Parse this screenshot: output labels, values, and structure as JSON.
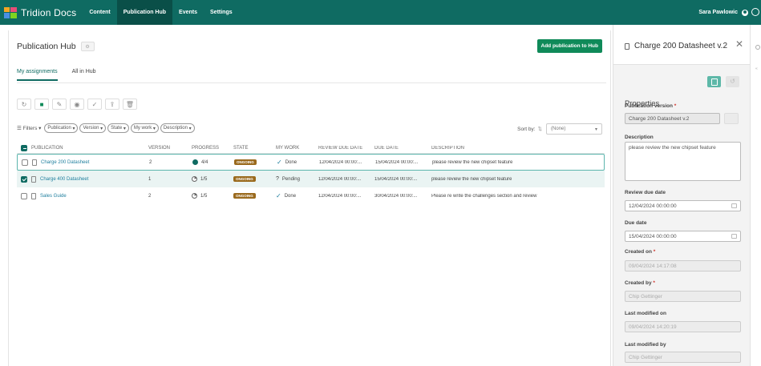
{
  "app": {
    "name": "Tridion Docs"
  },
  "nav": [
    "Content",
    "Publication Hub",
    "Events",
    "Settings"
  ],
  "user": {
    "name": "Sara Pawlowic"
  },
  "page": {
    "title": "Publication Hub",
    "add_button": "Add publication to Hub"
  },
  "tabs": [
    "My assignments",
    "All in Hub"
  ],
  "filters": {
    "label": "Filters",
    "chips": [
      "Publication",
      "Version",
      "State",
      "My work",
      "Description"
    ]
  },
  "sort": {
    "label": "Sort by:",
    "value": "(None)"
  },
  "columns": [
    "PUBLICATION",
    "VERSION",
    "PROGRESS",
    "STATE",
    "MY WORK",
    "REVIEW DUE DATE",
    "DUE DATE",
    "DESCRIPTION"
  ],
  "rows": [
    {
      "publication": "Charge 200 Datasheet",
      "version": "2",
      "progress": "4/4",
      "state": "ONGOING",
      "my_work": "Done",
      "review_due": "12/04/2024 00:00:...",
      "due": "15/04/2024 00:00:...",
      "description": "please review the new chipset feature"
    },
    {
      "publication": "Charge 400 Datasheet",
      "version": "1",
      "progress": "1/5",
      "state": "ONGOING",
      "my_work": "Pending",
      "review_due": "12/04/2024 00:00:...",
      "due": "15/04/2024 00:00:...",
      "description": "please review the new chipset feature"
    },
    {
      "publication": "Sales Guide",
      "version": "2",
      "progress": "1/5",
      "state": "ONGOING",
      "my_work": "Done",
      "review_due": "12/04/2024 00:00:...",
      "due": "30/04/2024 00:00:...",
      "description": "Please re write the challenges section and review"
    }
  ],
  "panel": {
    "title": "Charge 200 Datasheet v.2",
    "properties": "Properties",
    "pub_version_label": "Publication version",
    "pub_version_value": "Charge 200 Datasheet v.2",
    "description_label": "Description",
    "description_value": "please review the new chipset feature",
    "review_due_label": "Review due date",
    "review_due_value": "12/04/2024 00:00:00",
    "due_label": "Due date",
    "due_value": "15/04/2024 00:00:00",
    "created_on_label": "Created on",
    "created_on_value": "09/04/2024 14:17:08",
    "created_by_label": "Created by",
    "created_by_value": "Chip Gettinger",
    "modified_on_label": "Last modified on",
    "modified_on_value": "09/04/2024 14:20:19",
    "modified_by_label": "Last modified by",
    "modified_by_value": "Chip Gettinger",
    "required_mark": "*"
  }
}
